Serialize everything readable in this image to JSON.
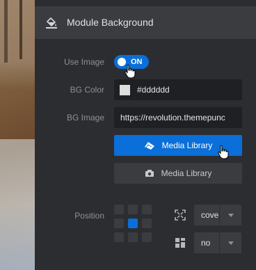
{
  "section": {
    "title": "Module Background",
    "icon": "paint-bucket-icon"
  },
  "use_image": {
    "label": "Use Image",
    "state": "ON",
    "on": true
  },
  "bg_color": {
    "label": "BG Color",
    "value": "#dddddd",
    "swatch": "#dddddd"
  },
  "bg_image": {
    "label": "BG Image",
    "value": "https://revolution.themepunc"
  },
  "buttons": {
    "media_library_primary": "Media Library",
    "media_library_secondary": "Media Library"
  },
  "position": {
    "label": "Position",
    "selected_cell": 4,
    "size_value": "cove",
    "repeat_value": "no"
  },
  "colors": {
    "accent": "#0a6fd8",
    "panel": "#2c2d30",
    "field": "#1f2023",
    "header": "#3b3c40"
  }
}
